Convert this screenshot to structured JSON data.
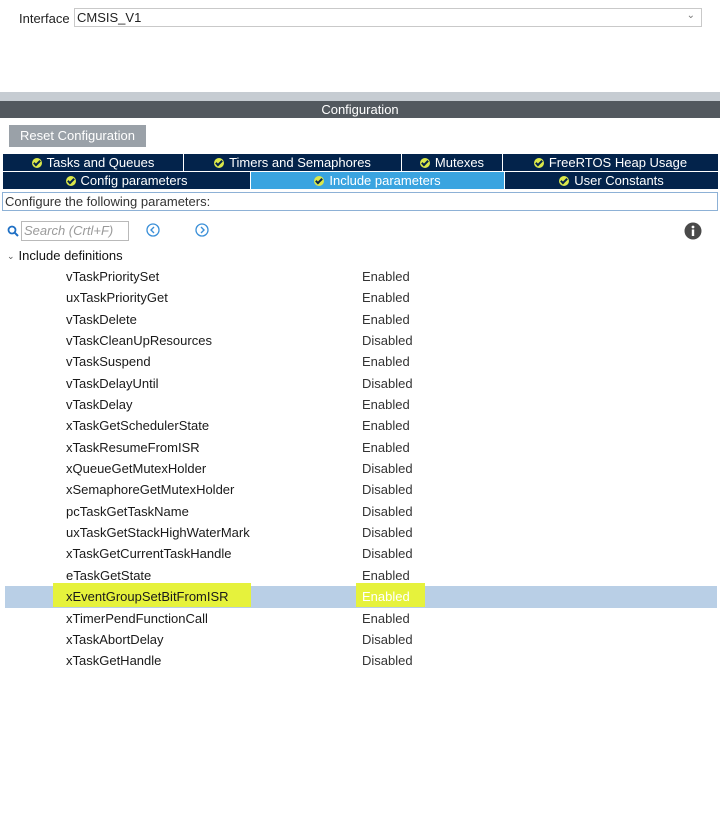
{
  "interface": {
    "label": "Interface",
    "value": "CMSIS_V1"
  },
  "configuration": {
    "title": "Configuration"
  },
  "reset_button": {
    "label": "Reset Configuration"
  },
  "tabs_row1": [
    "Tasks and Queues",
    "Timers and Semaphores",
    "Mutexes",
    "FreeRTOS Heap Usage"
  ],
  "tabs_row2": [
    "Config parameters",
    "Include parameters",
    "User Constants"
  ],
  "active_tab": "Include parameters",
  "description": "Configure the following parameters:",
  "search": {
    "placeholder": "Search (Crtl+F)"
  },
  "tree": {
    "group_label": "Include definitions"
  },
  "params": [
    {
      "name": "vTaskPrioritySet",
      "value": "Enabled"
    },
    {
      "name": "uxTaskPriorityGet",
      "value": "Enabled"
    },
    {
      "name": "vTaskDelete",
      "value": "Enabled"
    },
    {
      "name": "vTaskCleanUpResources",
      "value": "Disabled"
    },
    {
      "name": "vTaskSuspend",
      "value": "Enabled"
    },
    {
      "name": "vTaskDelayUntil",
      "value": "Disabled"
    },
    {
      "name": "vTaskDelay",
      "value": "Enabled"
    },
    {
      "name": "xTaskGetSchedulerState",
      "value": "Enabled"
    },
    {
      "name": "xTaskResumeFromISR",
      "value": "Enabled"
    },
    {
      "name": "xQueueGetMutexHolder",
      "value": "Disabled"
    },
    {
      "name": "xSemaphoreGetMutexHolder",
      "value": "Disabled"
    },
    {
      "name": "pcTaskGetTaskName",
      "value": "Disabled"
    },
    {
      "name": "uxTaskGetStackHighWaterMark",
      "value": "Disabled"
    },
    {
      "name": "xTaskGetCurrentTaskHandle",
      "value": "Disabled"
    },
    {
      "name": "eTaskGetState",
      "value": "Enabled"
    },
    {
      "name": "xEventGroupSetBitFromISR",
      "value": "Enabled"
    },
    {
      "name": "xTimerPendFunctionCall",
      "value": "Enabled"
    },
    {
      "name": "xTaskAbortDelay",
      "value": "Disabled"
    },
    {
      "name": "xTaskGetHandle",
      "value": "Disabled"
    }
  ],
  "selected_param": "xEventGroupSetBitFromISR",
  "colors": {
    "tab_bg": "#03234b",
    "tab_active": "#3aa4e0",
    "check": "#dbe84a",
    "highlight": "#e6f23c",
    "selected_row": "#b9cfe6",
    "header_bar": "#53595f"
  }
}
